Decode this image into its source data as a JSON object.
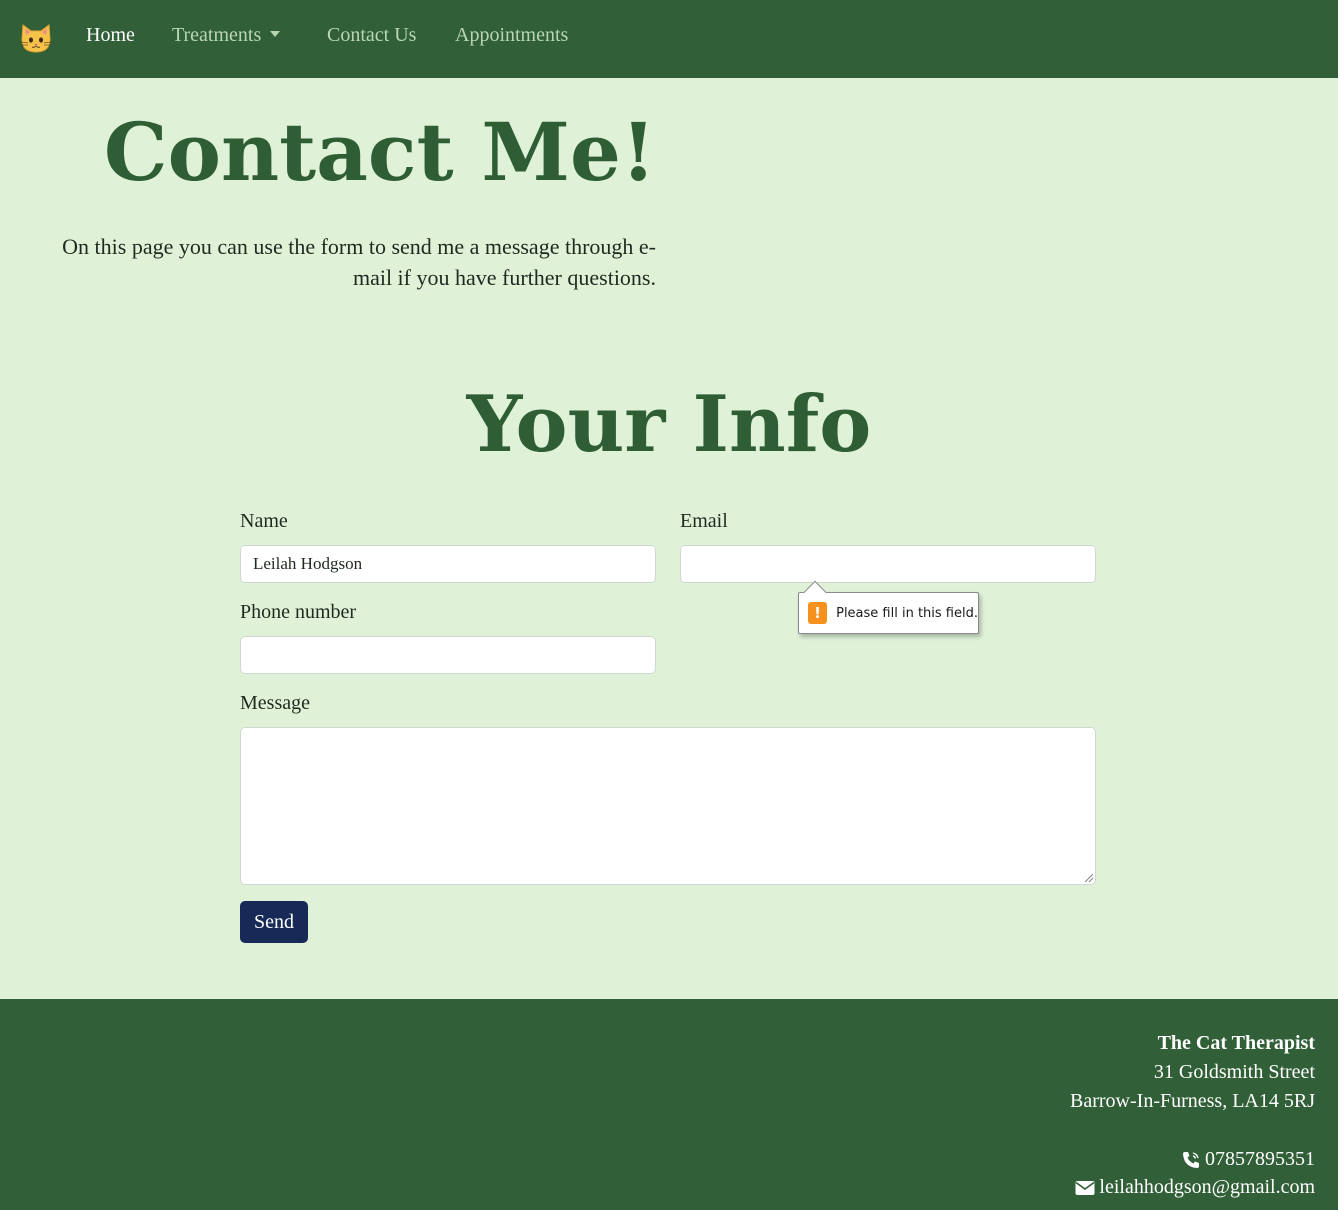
{
  "nav": {
    "logo_icon": "cat-face-icon",
    "items": [
      {
        "label": "Home",
        "active": true
      },
      {
        "label": "Treatments",
        "dropdown": true
      },
      {
        "label": "Contact Us"
      },
      {
        "label": "Appointments"
      }
    ]
  },
  "hero": {
    "title": "Contact Me!",
    "text_line1": "On this page you can use the form to send me a message through e-",
    "text_line2": "mail if you have further questions."
  },
  "form": {
    "title": "Your Info",
    "name_label": "Name",
    "name_value": "Leilah Hodgson",
    "email_label": "Email",
    "email_value": "",
    "phone_label": "Phone number",
    "phone_value": "",
    "message_label": "Message",
    "message_value": "",
    "send_label": "Send"
  },
  "tooltip": {
    "icon": "warning-icon",
    "text": "Please fill in this field."
  },
  "footer": {
    "business_name": "The Cat Therapist",
    "address_line1": "31 Goldsmith Street",
    "address_line2": "Barrow-In-Furness, LA14 5RJ",
    "phone": "07857895351",
    "email": "leilahhodgson@gmail.com",
    "phone_icon": "phone-icon",
    "email_icon": "envelope-icon"
  },
  "colors": {
    "nav_bg": "#315f37",
    "page_bg": "#dff2d8",
    "heading": "#2f5e35",
    "button": "#172a57",
    "warning": "#f7911e"
  }
}
